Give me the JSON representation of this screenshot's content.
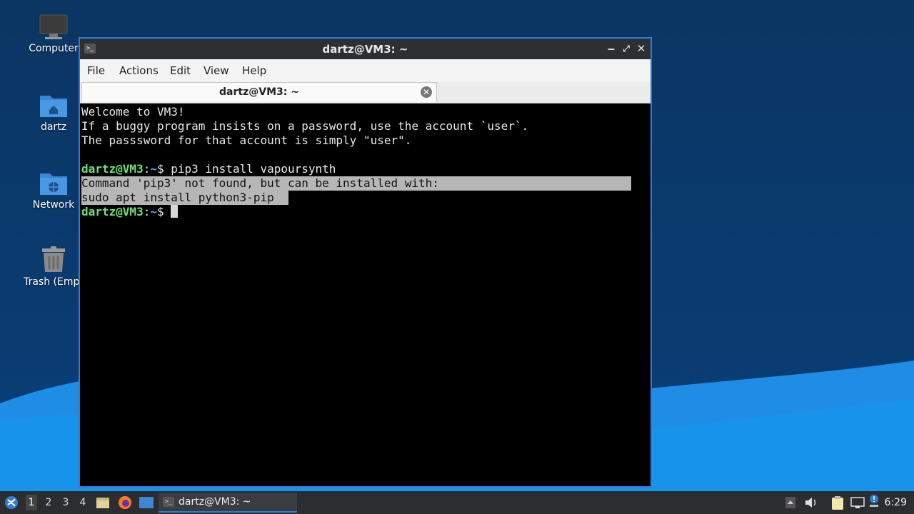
{
  "desktop": {
    "icons": [
      {
        "label": "Computer"
      },
      {
        "label": "dartz"
      },
      {
        "label": "Network"
      },
      {
        "label": "Trash (Empt"
      }
    ]
  },
  "window": {
    "title": "dartz@VM3: ~",
    "app_icon": ">_",
    "controls": {
      "minimize": "‒",
      "maximize": "⤢",
      "close": "✕"
    },
    "menu": [
      "File",
      "Actions",
      "Edit",
      "View",
      "Help"
    ],
    "tab": {
      "label": "dartz@VM3: ~",
      "close": "✕"
    }
  },
  "terminal": {
    "welcome": [
      "Welcome to VM3!",
      "If a buggy program insists on a password, use the account `user`.",
      "The passsword for that account is simply \"user\"."
    ],
    "prompt_user": "dartz@VM3",
    "prompt_sep": ":",
    "prompt_path": "~",
    "prompt_sign": "$ ",
    "command": "pip3 install vapoursynth",
    "output": [
      "Command 'pip3' not found, but can be installed with:",
      "sudo apt install python3-pip"
    ]
  },
  "taskbar": {
    "workspaces": [
      "1",
      "2",
      "3",
      "4"
    ],
    "task_label": "dartz@VM3: ~",
    "clock": "6:29"
  },
  "colors": {
    "prompt_user": "#6fe07d",
    "prompt_path": "#6aa5ff",
    "selection": "#b6b6b6",
    "window_border": "#2f7bd6"
  }
}
